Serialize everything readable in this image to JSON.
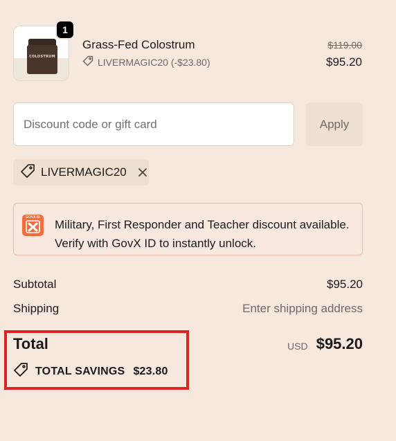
{
  "product": {
    "name": "Grass-Fed Colostrum",
    "quantity": "1",
    "discount_line": "LIVERMAGIC20 (-$23.80)",
    "original_price": "$119.00",
    "discounted_price": "$95.20",
    "jar_label": "COLOSTRUM"
  },
  "discount": {
    "placeholder": "Discount code or gift card",
    "apply_label": "Apply",
    "applied_code": "LIVERMAGIC20"
  },
  "govx": {
    "logo_text": "GOVX ID",
    "line1": "Military, First Responder and Teacher discount available.",
    "line2": "Verify with GovX ID to instantly unlock.",
    "brand_color": "#f26d3d"
  },
  "summary": {
    "subtotal_label": "Subtotal",
    "subtotal_value": "$95.20",
    "shipping_label": "Shipping",
    "shipping_value": "Enter shipping address",
    "total_label": "Total",
    "currency": "USD",
    "total_value": "$95.20",
    "savings_label": "TOTAL SAVINGS",
    "savings_value": "$23.80"
  },
  "colors": {
    "background": "#f6e8dc",
    "highlight": "#e02222"
  }
}
